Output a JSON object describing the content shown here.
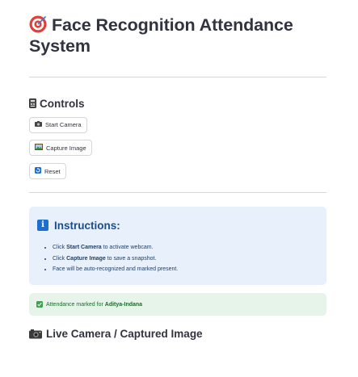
{
  "page": {
    "title": "Face Recognition Attendance System",
    "title_icon": "target-icon"
  },
  "controls": {
    "heading": "Controls",
    "heading_icon": "control-panel-icon",
    "buttons": [
      {
        "label": "Start Camera",
        "icon": "camera-icon"
      },
      {
        "label": "Capture Image",
        "icon": "image-icon"
      },
      {
        "label": "Reset",
        "icon": "reset-icon"
      }
    ]
  },
  "instructions": {
    "title": "Instructions:",
    "icon": "info-icon",
    "items": [
      {
        "pre": "Click ",
        "bold": "Start Camera",
        "post": " to activate webcam."
      },
      {
        "pre": "Click ",
        "bold": "Capture Image",
        "post": " to save a snapshot."
      },
      {
        "pre": "Face will be auto-recognized and marked present.",
        "bold": "",
        "post": ""
      }
    ]
  },
  "status": {
    "prefix": "Attendance marked for ",
    "name": "Aditya-Indana",
    "icon": "check-icon"
  },
  "live": {
    "heading": "Live Camera / Captured Image",
    "icon": "camera-icon"
  },
  "colors": {
    "info_bg": "#e8f1fb",
    "info_title": "#1a4e91",
    "success_bg": "#e6f4ea",
    "success_text": "#1d6b2f",
    "divider": "#d6d6d9"
  }
}
